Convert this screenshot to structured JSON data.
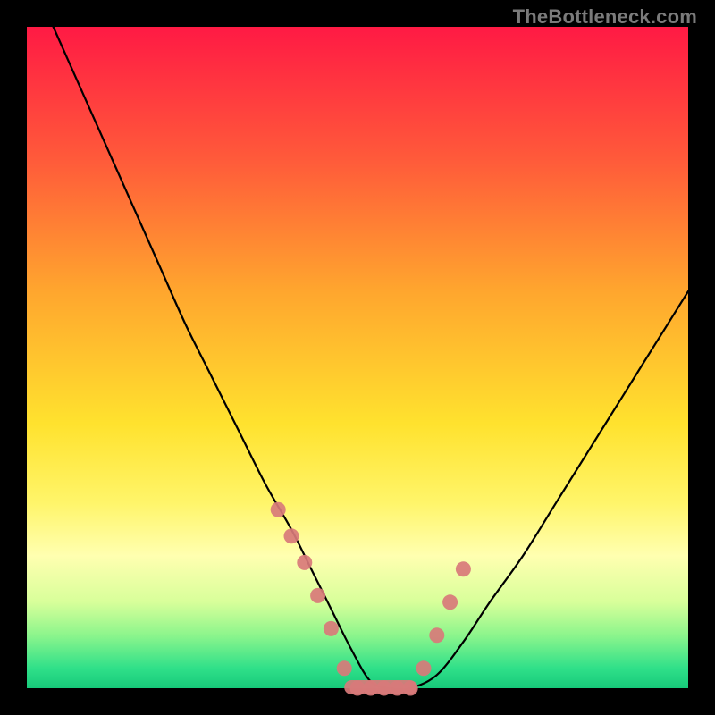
{
  "watermark": "TheBottleneck.com",
  "chart_data": {
    "type": "line",
    "title": "",
    "xlabel": "",
    "ylabel": "",
    "xlim": [
      0,
      100
    ],
    "ylim": [
      0,
      100
    ],
    "background_gradient": {
      "stops": [
        {
          "offset": 0.0,
          "color": "#ff1a44"
        },
        {
          "offset": 0.2,
          "color": "#ff5a3a"
        },
        {
          "offset": 0.4,
          "color": "#ffa62e"
        },
        {
          "offset": 0.6,
          "color": "#ffe22e"
        },
        {
          "offset": 0.72,
          "color": "#fff56a"
        },
        {
          "offset": 0.8,
          "color": "#ffffb0"
        },
        {
          "offset": 0.87,
          "color": "#d8ff9a"
        },
        {
          "offset": 0.92,
          "color": "#8cf58c"
        },
        {
          "offset": 0.97,
          "color": "#2fe089"
        },
        {
          "offset": 1.0,
          "color": "#17c97a"
        }
      ]
    },
    "series": [
      {
        "name": "bottleneck-curve",
        "type": "line",
        "color": "#000000",
        "x": [
          4,
          8,
          12,
          16,
          20,
          24,
          28,
          32,
          36,
          40,
          43,
          46,
          49,
          52,
          55,
          58,
          62,
          66,
          70,
          75,
          80,
          85,
          90,
          95,
          100
        ],
        "y": [
          100,
          91,
          82,
          73,
          64,
          55,
          47,
          39,
          31,
          24,
          18,
          12,
          6,
          1,
          0,
          0,
          2,
          7,
          13,
          20,
          28,
          36,
          44,
          52,
          60
        ]
      },
      {
        "name": "data-markers",
        "type": "scatter",
        "color": "#d87a7a",
        "x": [
          38,
          40,
          42,
          44,
          46,
          48,
          50,
          52,
          54,
          56,
          58,
          60,
          62,
          64,
          66
        ],
        "y": [
          27,
          23,
          19,
          14,
          9,
          3,
          0,
          0,
          0,
          0,
          0,
          3,
          8,
          13,
          18
        ]
      }
    ]
  }
}
